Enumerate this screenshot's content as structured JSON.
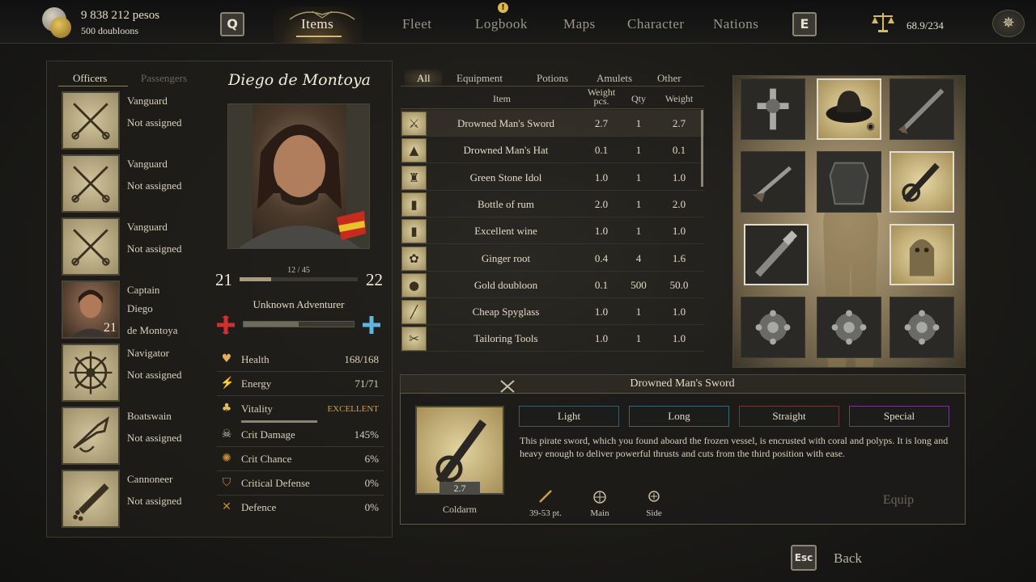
{
  "topbar": {
    "pesos": "9 838 212 pesos",
    "doubloons": "500 doubloons",
    "key_left": "Q",
    "key_right": "E",
    "tabs": [
      {
        "label": "Items",
        "active": true
      },
      {
        "label": "Fleet",
        "active": false
      },
      {
        "label": "Logbook",
        "active": false,
        "alert": "!"
      },
      {
        "label": "Maps",
        "active": false
      },
      {
        "label": "Character",
        "active": false
      },
      {
        "label": "Nations",
        "active": false
      }
    ],
    "weight": "68.9/234"
  },
  "officers": {
    "tab_officers": "Officers",
    "tab_passengers": "Passengers",
    "list": [
      {
        "role": "Vanguard",
        "name": "Not assigned",
        "icon": "crossed-swords-icon"
      },
      {
        "role": "Vanguard",
        "name": "Not assigned",
        "icon": "crossed-swords-icon"
      },
      {
        "role": "Vanguard",
        "name": "Not assigned",
        "icon": "crossed-swords-icon"
      },
      {
        "role": "Captain",
        "name": "Diego",
        "name2": "de Montoya",
        "level": "21",
        "icon": "captain-portrait"
      },
      {
        "role": "Navigator",
        "name": "Not assigned",
        "icon": "ship-wheel-icon"
      },
      {
        "role": "Boatswain",
        "name": "Not assigned",
        "icon": "bugle-icon"
      },
      {
        "role": "Cannoneer",
        "name": "Not assigned",
        "icon": "cannon-icon"
      }
    ]
  },
  "character": {
    "name": "Diego de Montoya",
    "xp_text": "12 / 45",
    "xp_fraction": 0.27,
    "level_current": "21",
    "level_next": "22",
    "title": "Unknown Adventurer",
    "rank_fraction": 0.5,
    "stats": [
      {
        "label": "Health",
        "value": "168/168",
        "icon": "heart-icon"
      },
      {
        "label": "Energy",
        "value": "71/71",
        "icon": "energy-icon"
      },
      {
        "label": "Vitality",
        "value": "EXCELLENT",
        "icon": "clover-icon",
        "color": "#c4a060"
      },
      {
        "label": "Crit Damage",
        "value": "145%",
        "icon": "skull-icon"
      },
      {
        "label": "Crit Chance",
        "value": "6%",
        "icon": "target-icon"
      },
      {
        "label": "Critical Defense",
        "value": "0%",
        "icon": "shield-icon"
      },
      {
        "label": "Defence",
        "value": "0%",
        "icon": "crossed-blades-icon"
      }
    ]
  },
  "items": {
    "filters": [
      {
        "label": "All",
        "active": true
      },
      {
        "label": "Equipment",
        "active": false
      },
      {
        "label": "Potions",
        "active": false
      },
      {
        "label": "Amulets",
        "active": false
      },
      {
        "label": "Other",
        "active": false
      }
    ],
    "columns": {
      "item": "Item",
      "weight_pcs": "Weight",
      "weight_pcs2": "pcs.",
      "qty": "Qty",
      "weight": "Weight"
    },
    "rows": [
      {
        "name": "Drowned Man's Sword",
        "wpcs": "2.7",
        "qty": "1",
        "weight": "2.7",
        "icon": "sword-icon",
        "selected": true
      },
      {
        "name": "Drowned Man's Hat",
        "wpcs": "0.1",
        "qty": "1",
        "weight": "0.1",
        "icon": "hat-icon"
      },
      {
        "name": "Green Stone Idol",
        "wpcs": "1.0",
        "qty": "1",
        "weight": "1.0",
        "icon": "idol-icon"
      },
      {
        "name": "Bottle of rum",
        "wpcs": "2.0",
        "qty": "1",
        "weight": "2.0",
        "icon": "bottle-icon"
      },
      {
        "name": "Excellent wine",
        "wpcs": "1.0",
        "qty": "1",
        "weight": "1.0",
        "icon": "wine-icon"
      },
      {
        "name": "Ginger root",
        "wpcs": "0.4",
        "qty": "4",
        "weight": "1.6",
        "icon": "ginger-icon"
      },
      {
        "name": "Gold doubloon",
        "wpcs": "0.1",
        "qty": "500",
        "weight": "50.0",
        "icon": "coin-icon"
      },
      {
        "name": "Cheap Spyglass",
        "wpcs": "1.0",
        "qty": "1",
        "weight": "1.0",
        "icon": "spyglass-icon"
      },
      {
        "name": "Tailoring Tools",
        "wpcs": "1.0",
        "qty": "1",
        "weight": "1.0",
        "icon": "tools-icon"
      }
    ]
  },
  "details": {
    "title": "Drowned Man's Sword",
    "weight": "2.7",
    "type": "Coldarm",
    "traits": [
      {
        "label": "Light",
        "color": "#3c5a66"
      },
      {
        "label": "Long",
        "color": "#3e6670"
      },
      {
        "label": "Straight",
        "color": "#6a3a3a"
      },
      {
        "label": "Special",
        "color": "#6a3e86"
      }
    ],
    "description": "This pirate sword, which you found aboard the frozen vessel, is encrusted with coral and polyps. It is long and heavy enough to deliver powerful thrusts and cuts from the third position with ease.",
    "damage": "39-53 pt.",
    "main": "Main",
    "side": "Side",
    "equip": "Equip"
  },
  "footer": {
    "key": "Esc",
    "back": "Back"
  }
}
